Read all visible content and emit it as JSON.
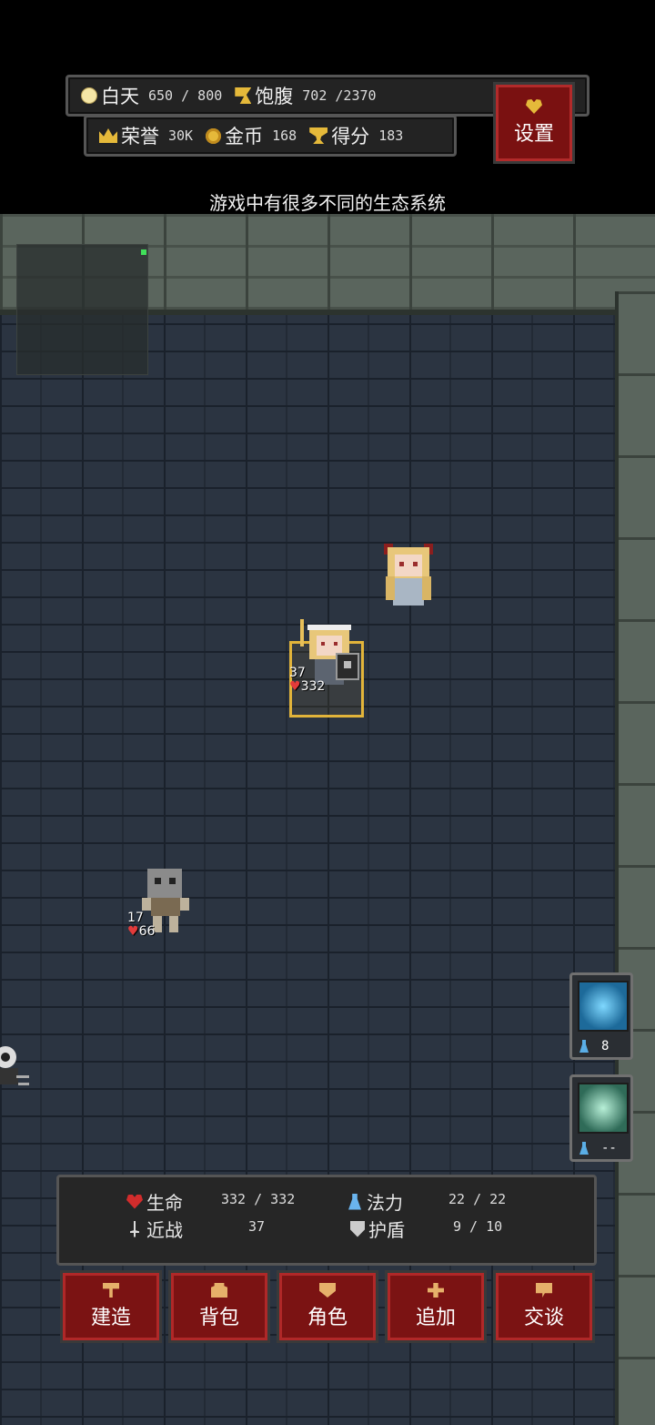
{
  "hud": {
    "daytime": {
      "label": "白天",
      "value": "650 / 800"
    },
    "satiety": {
      "label": "饱腹",
      "value": "702 /2370"
    },
    "honor": {
      "label": "荣誉",
      "value": "30K"
    },
    "gold": {
      "label": "金币",
      "value": "168"
    },
    "score": {
      "label": "得分",
      "value": "183"
    },
    "settings_label": "设置"
  },
  "tip": "游戏中有很多不同的生态系统",
  "player": {
    "melee": "37",
    "hp": "332"
  },
  "enemy_skeleton": {
    "melee": "17",
    "hp": "66"
  },
  "skills": [
    {
      "icon": "lightning-icon",
      "cost": "8"
    },
    {
      "icon": "shield-icon",
      "cost": "--"
    }
  ],
  "stats": {
    "hp": {
      "label": "生命",
      "value": "332 / 332"
    },
    "mana": {
      "label": "法力",
      "value": "22 / 22"
    },
    "melee": {
      "label": "近战",
      "value": "37"
    },
    "shield": {
      "label": "护盾",
      "value": "9 / 10"
    }
  },
  "actions": {
    "build": "建造",
    "bag": "背包",
    "character": "角色",
    "add": "追加",
    "talk": "交谈"
  }
}
